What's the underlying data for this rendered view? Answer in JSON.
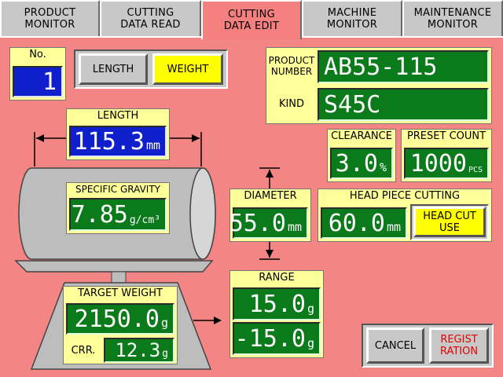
{
  "tabs": [
    {
      "label": "PRODUCT\nMONITOR"
    },
    {
      "label": "CUTTING\nDATA READ"
    },
    {
      "label": "CUTTING\nDATA EDIT"
    },
    {
      "label": "MACHINE\nMONITOR"
    },
    {
      "label": "MAINTENANCE\nMONITOR"
    }
  ],
  "no": {
    "label": "No.",
    "value": "1"
  },
  "mode_buttons": {
    "length": "LENGTH",
    "weight": "WEIGHT",
    "selected": "WEIGHT"
  },
  "product": {
    "number_label": "PRODUCT\nNUMBER",
    "number_value": "AB55-115",
    "kind_label": "KIND",
    "kind_value": "S45C"
  },
  "length": {
    "label": "LENGTH",
    "value": "115.3",
    "unit": "mm"
  },
  "specific_gravity": {
    "label": "SPECIFIC GRAVITY",
    "value": "7.85",
    "unit": "g/cm³"
  },
  "clearance": {
    "label": "CLEARANCE",
    "value": "3.0",
    "unit": "%"
  },
  "preset_count": {
    "label": "PRESET COUNT",
    "value": "1000",
    "unit": "PCS"
  },
  "diameter": {
    "label": "DIAMETER",
    "value": "55.0",
    "unit": "mm"
  },
  "head_piece": {
    "label": "HEAD PIECE CUTTING",
    "value": "60.0",
    "unit": "mm",
    "button": "HEAD CUT\nUSE"
  },
  "target_weight": {
    "label": "TARGET WEIGHT",
    "value": "2150.0",
    "unit": "g",
    "corr_label": "CRR.",
    "corr_value": "12.3",
    "corr_unit": "g"
  },
  "range": {
    "label": "RANGE",
    "upper": "15.0",
    "lower": "-15.0",
    "unit": "g"
  },
  "actions": {
    "cancel": "CANCEL",
    "register": "REGIST\nRATION"
  },
  "colors": {
    "panel": "#f48585",
    "value_green": "#0a7a1a",
    "value_blue": "#0f1fcc",
    "label_yellow": "#ffff99",
    "tab_gray": "#c8c8c8"
  }
}
